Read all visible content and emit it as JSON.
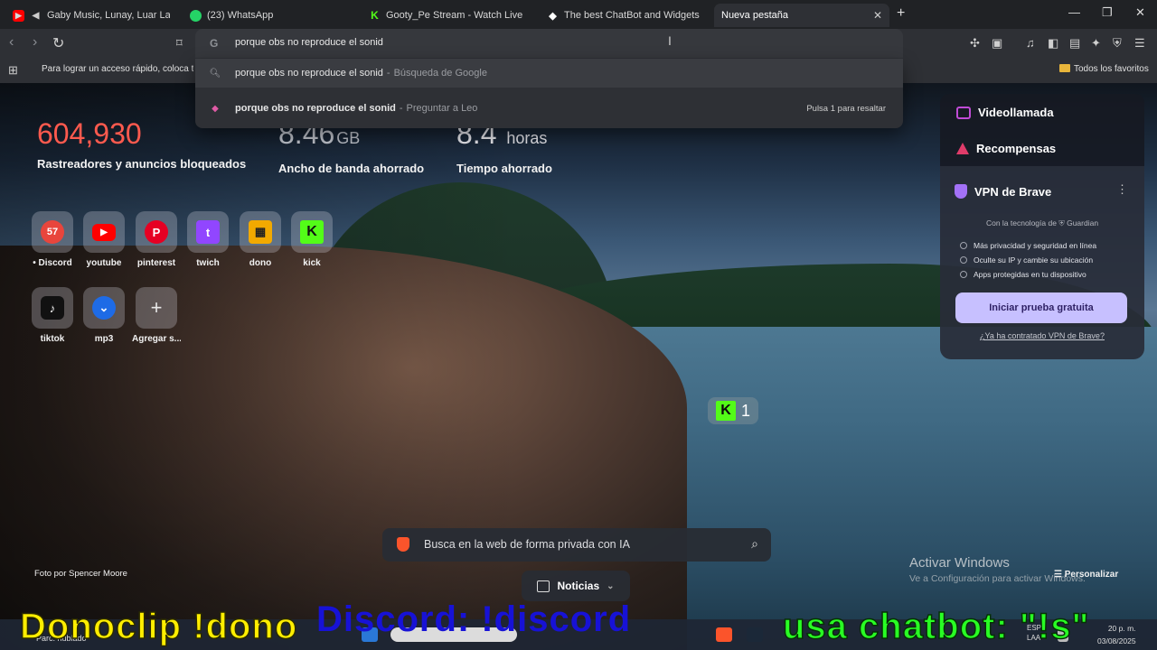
{
  "tabs": [
    {
      "label": "Gaby Music, Lunay, Luar La L - No",
      "icon": "youtube-icon",
      "color": "#ff0000"
    },
    {
      "label": "(23) WhatsApp",
      "icon": "whatsapp-icon",
      "color": "#25d366"
    },
    {
      "label": "Gooty_Pe Stream - Watch Live on Kic",
      "icon": "kick-icon",
      "color": "#53fc18"
    },
    {
      "label": "The best ChatBot and Widgets for Ki",
      "icon": "botrix-icon",
      "color": "#ffffff"
    },
    {
      "label": "Nueva pestaña",
      "icon": "brave-icon",
      "color": "#fb542b",
      "active": true
    }
  ],
  "omnibox": {
    "query": "porque obs no reproduce el sonid",
    "engine_icon": "G"
  },
  "suggestions": [
    {
      "main": "porque obs no reproduce el sonid",
      "sub": "Búsqueda de Google",
      "icon": "search-icon"
    },
    {
      "main": "porque obs no reproduce el sonid",
      "sub": "Preguntar a Leo",
      "icon": "leo-icon",
      "hint": "Pulsa 1 para resaltar"
    }
  ],
  "bookmarks": {
    "hint": "Para lograr un acceso rápido, coloca tus",
    "favorites": "Todos los favoritos"
  },
  "stats": [
    {
      "value": "604,930",
      "unit": "",
      "label": "Rastreadores y anuncios bloqueados"
    },
    {
      "value": "8.46",
      "unit": "GB",
      "label": "Ancho de banda ahorrado"
    },
    {
      "value": "8.4",
      "unit": "horas",
      "label": "Tiempo ahorrado"
    }
  ],
  "top_sites": [
    {
      "name": "• Discord",
      "glyph": "57",
      "color": "#e8453c"
    },
    {
      "name": "youtube",
      "glyph": "▶",
      "color": "#ff0000"
    },
    {
      "name": "pinterest",
      "glyph": "P",
      "color": "#e60023"
    },
    {
      "name": "twich",
      "glyph": "t",
      "color": "#9146ff"
    },
    {
      "name": "dono",
      "glyph": "▦",
      "color": "#f2a900"
    },
    {
      "name": "kick",
      "glyph": "K",
      "color": "#53fc18"
    },
    {
      "name": "tiktok",
      "glyph": "♪",
      "color": "#111111"
    },
    {
      "name": "mp3",
      "glyph": "⌄",
      "color": "#1e6be6"
    },
    {
      "name": "Agregar s...",
      "glyph": "+",
      "color": "transparent"
    }
  ],
  "panel": {
    "video_call": "Videollamada",
    "rewards": "Recompensas",
    "vpn_title": "VPN de Brave",
    "powered_by": "Con la tecnología de",
    "powered_brand": "Guardian",
    "features": [
      "Más privacidad y seguridad en línea",
      "Oculte su IP y cambie su ubicación",
      "Apps protegidas en tu dispositivo"
    ],
    "cta": "Iniciar prueba gratuita",
    "link": "¿Ya ha contratado VPN de Brave?"
  },
  "kick_badge": {
    "letter": "K",
    "count": "1"
  },
  "search": {
    "placeholder": "Busca en la web de forma privada con IA"
  },
  "news": "Noticias",
  "photo_credit": "Foto por Spencer Moore",
  "windows_activation": {
    "title": "Activar Windows",
    "subtitle": "Ve a Configuración para activar Windows."
  },
  "customize": "Personalizar",
  "taskbar": {
    "weather": "Parc. nublado",
    "lang": "ESP",
    "lang2": "LAA",
    "time": "20 p. m.",
    "date": "03/08/2025"
  },
  "overlay": {
    "left": "Donoclip !dono",
    "middle": "Discord: !discord",
    "right": "usa chatbot: \"!s\""
  }
}
